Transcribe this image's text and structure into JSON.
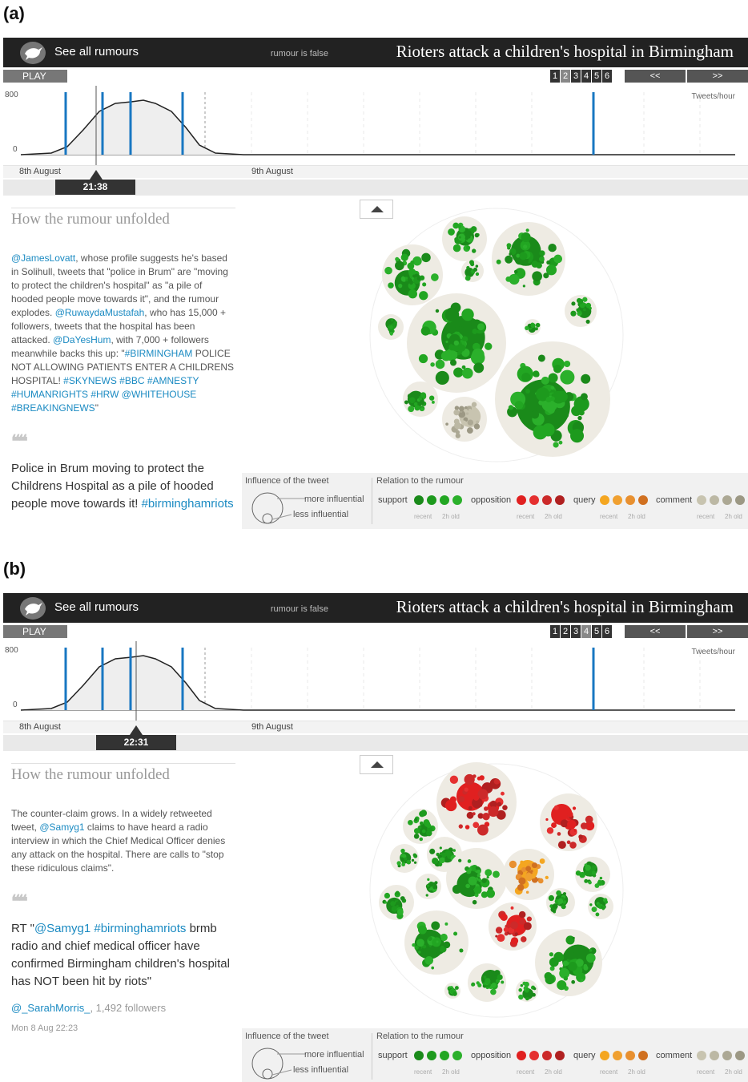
{
  "panels": [
    {
      "label": "(a)",
      "header": {
        "see_all": "See all rumours",
        "status": "rumour is false",
        "title": "Rioters attack a children's hospital in Birmingham"
      },
      "controls": {
        "play": "PLAY",
        "pages": [
          "1",
          "2",
          "3",
          "4",
          "5",
          "6"
        ],
        "prev": "<<",
        "next": ">>"
      },
      "timeline": {
        "y_max": "800",
        "y_min": "0",
        "unit": "Tweets/hour",
        "date1": "8th August",
        "date2": "9th August",
        "current_time": "21:38"
      },
      "story": {
        "heading": "How the rumour unfolded",
        "text": [
          {
            "t": "@JamesLovatt",
            "link": true
          },
          {
            "t": ", whose profile suggests he's based in Solihull, tweets that \"police in Brum\" are \"moving to protect the children's hospital\" as \"a pile of hooded people move towards it\", and the rumour explodes. ",
            "link": false
          },
          {
            "t": "@RuwaydaMustafah",
            "link": true
          },
          {
            "t": ", who has 15,000 + followers, tweets that the hospital has been attacked. ",
            "link": false
          },
          {
            "t": "@DaYesHum",
            "link": true
          },
          {
            "t": ", with 7,000 + followers meanwhile backs this up: \"",
            "link": false
          },
          {
            "t": "#BIRMINGHAM",
            "link": true
          },
          {
            "t": " POLICE NOT ALLOWING PATIENTS ENTER A CHILDRENS HOSPITAL! ",
            "link": false
          },
          {
            "t": "#SKYNEWS #BBC #AMNESTY #HUMANRIGHTS #HRW @WHITEHOUSE #BREAKINGNEWS",
            "link": true
          },
          {
            "t": "\"",
            "link": false
          }
        ],
        "quote_mark": "❝❝",
        "quote": [
          {
            "t": "Police in Brum moving to protect the Childrens Hospital as a pile of hooded people move towards it! ",
            "link": false
          },
          {
            "t": "#birminghamriots",
            "link": true
          }
        ],
        "author_handle": "",
        "author_followers": "",
        "time": ""
      }
    },
    {
      "label": "(b)",
      "header": {
        "see_all": "See all rumours",
        "status": "rumour is false",
        "title": "Rioters attack a children's hospital in Birmingham"
      },
      "controls": {
        "play": "PLAY",
        "pages": [
          "1",
          "2",
          "3",
          "4",
          "5",
          "6"
        ],
        "prev": "<<",
        "next": ">>"
      },
      "timeline": {
        "y_max": "800",
        "y_min": "0",
        "unit": "Tweets/hour",
        "date1": "8th August",
        "date2": "9th August",
        "current_time": "22:31"
      },
      "story": {
        "heading": "How the rumour unfolded",
        "text": [
          {
            "t": "The counter-claim grows. In a widely retweeted tweet, ",
            "link": false
          },
          {
            "t": "@Samyg1",
            "link": true
          },
          {
            "t": " claims to have heard a radio interview in which the Chief Medical Officer denies any attack on the hospital. There are calls to \"stop these ridiculous claims\".",
            "link": false
          }
        ],
        "quote_mark": "❝❝",
        "quote": [
          {
            "t": "RT \"",
            "link": false
          },
          {
            "t": "@Samyg1 #birminghamriots",
            "link": true
          },
          {
            "t": " brmb radio and chief medical officer have confirmed Birmingham children's hospital has NOT been hit by riots\"",
            "link": false
          }
        ],
        "author_handle": "@_SarahMorris_",
        "author_followers": ", 1,492 followers",
        "time": "Mon 8 Aug 22:23"
      }
    }
  ],
  "legend": {
    "influence_title": "Influence of the tweet",
    "more": "more influential",
    "less": "less influential",
    "relation_title": "Relation to the rumour",
    "support": "support",
    "opposition": "opposition",
    "query": "query",
    "comment": "comment",
    "recent": "recent",
    "old": "2h old"
  },
  "colors": {
    "support": [
      "#1a8a1a",
      "#1d9a1d",
      "#22a622",
      "#2bb02b"
    ],
    "opposition": [
      "#e02020",
      "#e53030",
      "#cc2a2a",
      "#b02020"
    ],
    "query": [
      "#f4a620",
      "#f0a030",
      "#e89030",
      "#d07020"
    ],
    "comment": [
      "#c8c4b0",
      "#bcb8a4",
      "#aca894",
      "#9c9884"
    ],
    "cluster_bg": "#eeebe3"
  }
}
